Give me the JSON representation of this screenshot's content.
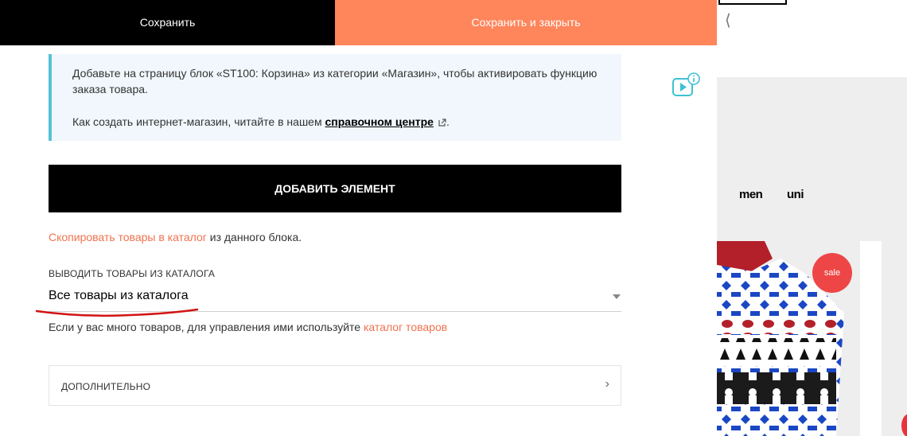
{
  "toolbar": {
    "save_label": "Сохранить",
    "save_close_label": "Сохранить и закрыть"
  },
  "info_box": {
    "paragraph1": "Добавьте на страницу блок «ST100: Корзина» из категории «Магазин», чтобы активировать функцию заказа товара.",
    "paragraph2_prefix": "Как создать интернет-магазин, читайте в нашем ",
    "help_link": "справочном центре",
    "paragraph2_suffix": "."
  },
  "add_element": {
    "label": "ДОБАВИТЬ ЭЛЕМЕНТ"
  },
  "copy": {
    "link": "Скопировать товары в каталог",
    "suffix": " из данного блока."
  },
  "catalog_source": {
    "label": "ВЫВОДИТЬ ТОВАРЫ ИЗ КАТАЛОГА",
    "selected": "Все товары из каталога",
    "hint_prefix": "Если у вас много товаров, для управления ими используйте ",
    "hint_link": "каталог товаров"
  },
  "advanced": {
    "label": "ДОПОЛНИТЕЛЬНО"
  },
  "preview": {
    "nav_items": [
      "men",
      "uni"
    ],
    "badge": "sale"
  },
  "colors": {
    "primary": "#000000",
    "accent": "#ff855b",
    "link": "#f0734f",
    "info_bg": "#f1f7fc",
    "info_border": "#55c3d4",
    "sale_badge": "#ee4646"
  }
}
